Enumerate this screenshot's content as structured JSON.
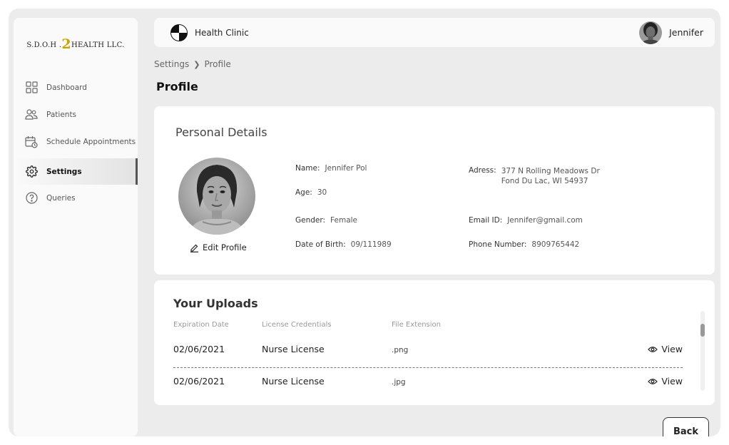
{
  "brand": {
    "prefix": "S.D.O.H .",
    "two": "2",
    "suffix": "HEALTH LLC."
  },
  "sidebar": {
    "items": [
      {
        "label": "Dashboard",
        "icon": "grid-icon"
      },
      {
        "label": "Patients",
        "icon": "users-icon"
      },
      {
        "label": "Schedule Appointments",
        "icon": "calendar-clock-icon"
      },
      {
        "label": "Settings",
        "icon": "gear-icon",
        "active": true
      },
      {
        "label": "Queries",
        "icon": "question-icon"
      }
    ]
  },
  "header": {
    "clinic_name": "Health Clinic",
    "user_name": "Jennifer"
  },
  "breadcrumb": {
    "parent": "Settings",
    "current": "Profile"
  },
  "page_title": "Profile",
  "personal": {
    "title": "Personal Details",
    "edit_label": "Edit Profile",
    "name_label": "Name:",
    "name": "Jennifer Pol",
    "age_label": "Age:",
    "age": "30",
    "gender_label": "Gender:",
    "gender": "Female",
    "dob_label": "Date of Birth:",
    "dob": "09/111989",
    "address_label": "Adress:",
    "address_line1": "377 N Rolling Meadows Dr",
    "address_line2": "Fond Du Lac, WI 54937",
    "email_label": "Email ID:",
    "email": "Jennifer@gmail.com",
    "phone_label": "Phone Number:",
    "phone": "8909765442"
  },
  "uploads": {
    "title": "Your Uploads",
    "columns": [
      "Expiration Date",
      "License Credentials",
      "File Extension"
    ],
    "rows": [
      {
        "date": "02/06/2021",
        "credential": "Nurse License",
        "ext": ".png",
        "action": "View"
      },
      {
        "date": "02/06/2021",
        "credential": "Nurse License",
        "ext": ".jpg",
        "action": "View"
      }
    ]
  },
  "back_label": "Back",
  "colors": {
    "brand_accent": "#c9a400",
    "background": "#ececec",
    "card": "#ffffff"
  }
}
